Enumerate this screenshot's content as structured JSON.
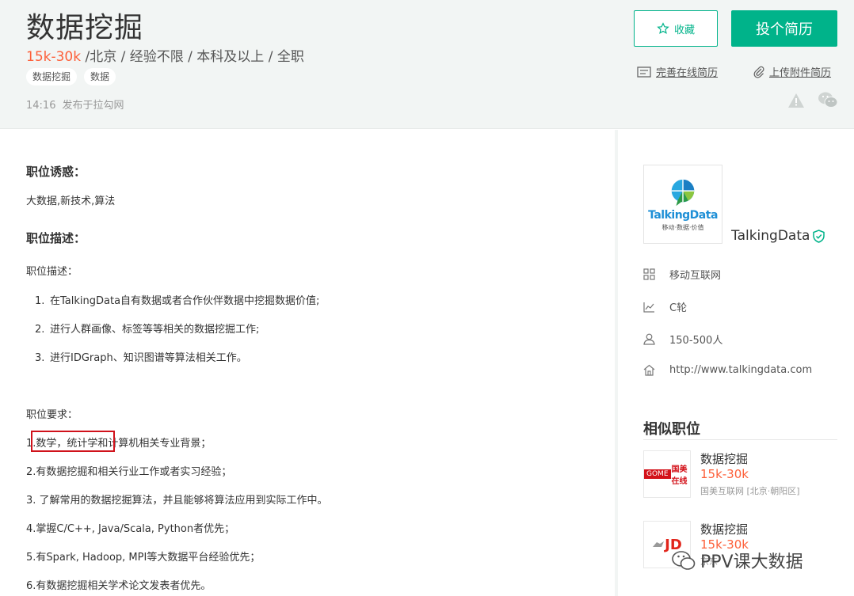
{
  "header": {
    "job_title": "数据挖掘",
    "salary": "15k-30k",
    "meta_rest": " /北京 / 经验不限 / 本科及以上 / 全职",
    "tags": [
      "数据挖掘",
      "数据"
    ],
    "post_time": "14:16",
    "post_source": "发布于拉勾网",
    "favorite_label": "收藏",
    "apply_label": "投个简历",
    "resume_online_label": "完善在线简历",
    "resume_upload_label": "上传附件简历"
  },
  "main": {
    "advantage_title": "职位诱惑：",
    "advantage_text": "大数据,新技术,算法",
    "desc_title": "职位描述：",
    "desc_sub": "职位描述：",
    "duties": [
      {
        "num": "1.",
        "text": "在TalkingData自有数据或者合作伙伴数据中挖掘数据价值;"
      },
      {
        "num": "2.",
        "text": "进行人群画像、标签等等相关的数据挖掘工作;"
      },
      {
        "num": "3.",
        "text": "进行IDGraph、知识图谱等算法相关工作。"
      }
    ],
    "req_title": "职位要求：",
    "requirements": [
      "1.数学，统计学和计算机相关专业背景；",
      "2.有数据挖掘和相关行业工作或者实习经验；",
      "3. 了解常用的数据挖掘算法，并且能够将算法应用到实际工作中。",
      "4.掌握C/C++, Java/Scala, Python者优先；",
      "5.有Spark, Hadoop, MPI等大数据平台经验优先；",
      "6.有数据挖掘相关学术论文发表者优先。"
    ]
  },
  "company": {
    "logo_text": "TalkingData",
    "logo_sub": "移动·数据·价值",
    "name": "TalkingData",
    "industry": "移动互联网",
    "stage": "C轮",
    "size": "150-500人",
    "website": "http://www.talkingdata.com"
  },
  "similar": {
    "title": "相似职位",
    "items": [
      {
        "title": "数据挖掘",
        "salary": "15k-30k",
        "company": "国美互联网 [北京·朝阳区]",
        "logo_text": "国美在线"
      },
      {
        "title": "数据挖掘",
        "salary": "15k-30k",
        "company": "京东",
        "logo_text": "JD"
      }
    ]
  },
  "watermark": "PPV课大数据",
  "colors": {
    "brand": "#00b38a",
    "salary": "#fd5f39",
    "highlight": "#d0121b"
  }
}
